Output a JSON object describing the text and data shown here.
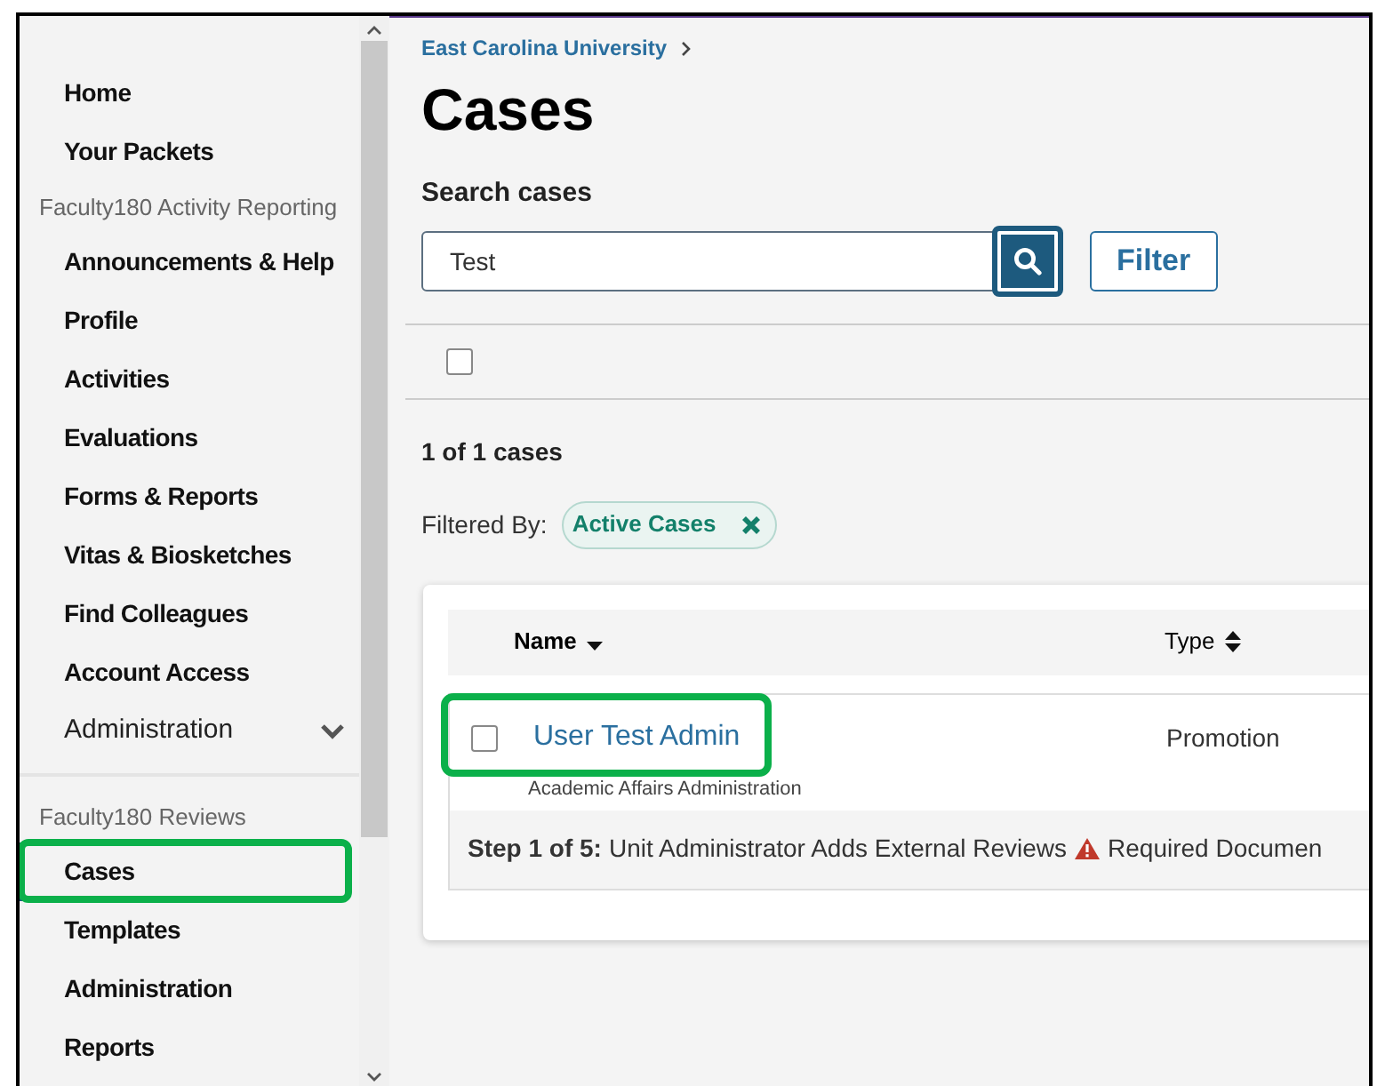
{
  "sidebar": {
    "items": [
      {
        "kind": "link",
        "label": "Home",
        "selected": false,
        "highlighted": false
      },
      {
        "kind": "link",
        "label": "Your Packets",
        "selected": false,
        "highlighted": false
      },
      {
        "kind": "header",
        "label": "Faculty180 Activity Reporting"
      },
      {
        "kind": "link",
        "label": "Announcements & Help",
        "selected": false,
        "highlighted": false
      },
      {
        "kind": "link",
        "label": "Profile",
        "selected": false,
        "highlighted": false
      },
      {
        "kind": "link",
        "label": "Activities",
        "selected": false,
        "highlighted": false
      },
      {
        "kind": "link",
        "label": "Evaluations",
        "selected": false,
        "highlighted": false
      },
      {
        "kind": "link",
        "label": "Forms & Reports",
        "selected": false,
        "highlighted": false
      },
      {
        "kind": "link",
        "label": "Vitas & Biosketches",
        "selected": false,
        "highlighted": false
      },
      {
        "kind": "link",
        "label": "Find Colleagues",
        "selected": false,
        "highlighted": false
      },
      {
        "kind": "link",
        "label": "Account Access",
        "selected": false,
        "highlighted": false
      },
      {
        "kind": "group",
        "label": "Administration",
        "expanded": false
      },
      {
        "kind": "divider"
      },
      {
        "kind": "header",
        "label": "Faculty180 Reviews"
      },
      {
        "kind": "link",
        "label": "Cases",
        "selected": true,
        "highlighted": true
      },
      {
        "kind": "link",
        "label": "Templates",
        "selected": false,
        "highlighted": false
      },
      {
        "kind": "link",
        "label": "Administration",
        "selected": false,
        "highlighted": false
      },
      {
        "kind": "link",
        "label": "Reports",
        "selected": false,
        "highlighted": false
      }
    ]
  },
  "breadcrumb": [
    "East Carolina University"
  ],
  "title": "Cases",
  "search": {
    "label": "Search cases",
    "value": "Test"
  },
  "filter_button": "Filter",
  "select_all": {
    "checked": false
  },
  "result_count": "1 of 1 cases",
  "filtered_by": {
    "label": "Filtered By:",
    "chips": [
      "Active Cases"
    ]
  },
  "table": {
    "columns": [
      {
        "label": "Name",
        "sorted": true
      },
      {
        "label": "Type",
        "sorted": false
      }
    ],
    "rows": [
      {
        "name": "User Test Admin",
        "unit": "Academic Affairs Administration",
        "type": "Promotion",
        "checked": false,
        "highlighted": true,
        "step_label": "Step 1 of 5:",
        "step_text": "Unit Administrator Adds External Reviews",
        "warning": "Required Documen"
      }
    ]
  }
}
